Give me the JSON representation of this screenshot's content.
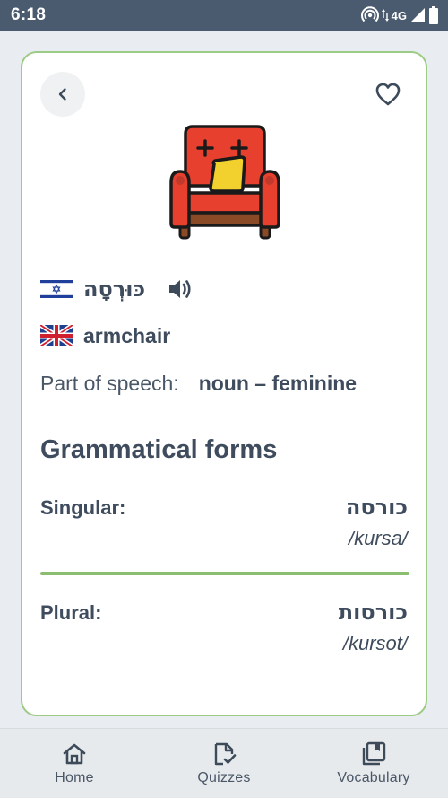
{
  "status_bar": {
    "time": "6:18",
    "network": "4G"
  },
  "card": {
    "back_icon": "chevron-left-icon",
    "favorite_icon": "heart-outline-icon",
    "illustration_icon": "armchair-icon",
    "hebrew_word": "כּוּרְסָה",
    "english_word": "armchair",
    "part_of_speech_label": "Part of speech:",
    "part_of_speech_value": "noun – feminine",
    "forms_title": "Grammatical forms",
    "singular_label": "Singular:",
    "singular_hebrew": "כורסה",
    "singular_translit": "/kursa/",
    "plural_label": "Plural:",
    "plural_hebrew": "כורסות",
    "plural_translit": "/kursot/",
    "accent_color": "#9ccb86"
  },
  "bottom_nav": {
    "items": [
      {
        "label": "Home",
        "icon": "home-icon"
      },
      {
        "label": "Quizzes",
        "icon": "quiz-icon"
      },
      {
        "label": "Vocabulary",
        "icon": "vocabulary-icon"
      }
    ]
  }
}
